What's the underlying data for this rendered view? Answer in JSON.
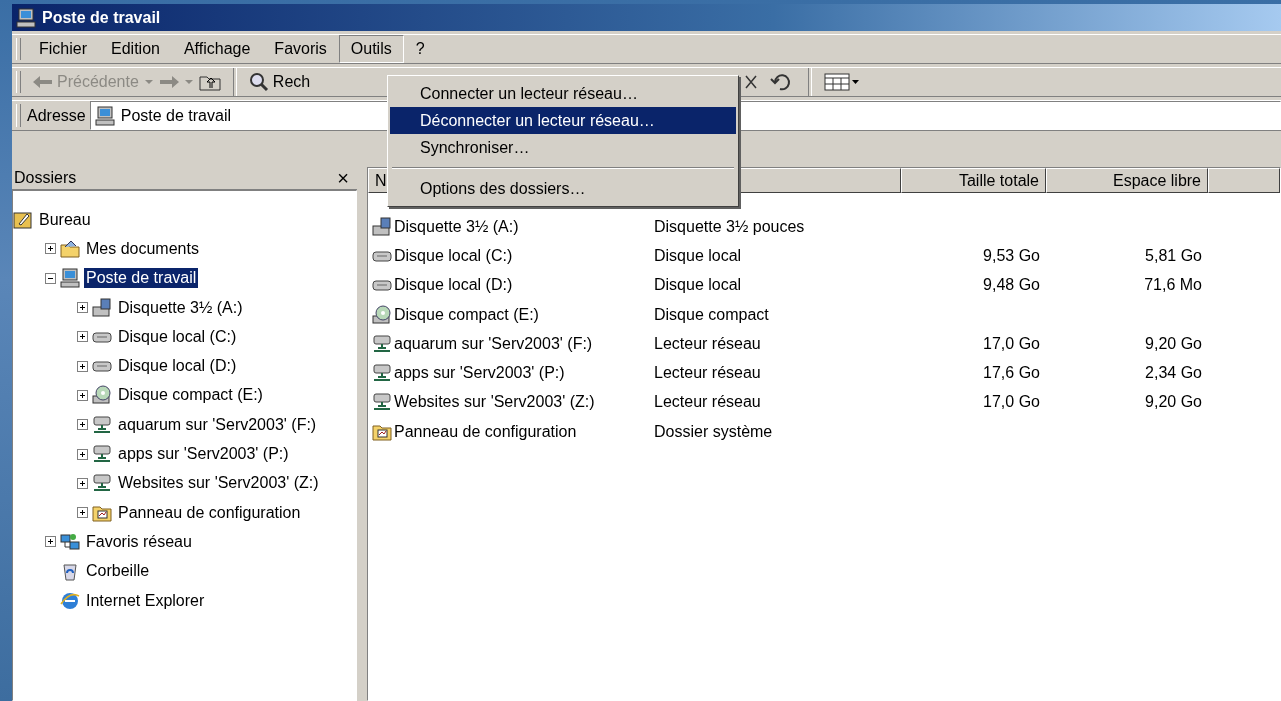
{
  "window": {
    "title": "Poste de travail"
  },
  "menu_bar": [
    {
      "label": "Fichier",
      "selected": false
    },
    {
      "label": "Edition",
      "selected": false
    },
    {
      "label": "Affichage",
      "selected": false
    },
    {
      "label": "Favoris",
      "selected": false
    },
    {
      "label": "Outils",
      "selected": true
    },
    {
      "label": "?",
      "selected": false
    }
  ],
  "toolbar": {
    "back": {
      "label": "Précédente",
      "disabled": true
    },
    "forward": {
      "disabled": true
    },
    "search": {
      "label": "Rech"
    }
  },
  "address": {
    "label": "Adresse",
    "value": "Poste de travail"
  },
  "folders": {
    "title": "Dossiers",
    "close": "×",
    "tree": [
      {
        "label": "Bureau",
        "kind": "desktop",
        "selected": false,
        "children": [
          {
            "label": "Mes documents",
            "kind": "documents",
            "expanded": false,
            "selected": false
          },
          {
            "label": "Poste de travail",
            "kind": "computer",
            "expanded": true,
            "selected": true,
            "children": [
              {
                "label": "Disquette 3½ (A:)",
                "kind": "floppy",
                "expanded": false,
                "selected": false
              },
              {
                "label": "Disque local (C:)",
                "kind": "harddisk",
                "expanded": false,
                "selected": false
              },
              {
                "label": "Disque local (D:)",
                "kind": "harddisk",
                "expanded": false,
                "selected": false
              },
              {
                "label": "Disque compact (E:)",
                "kind": "cdrom",
                "expanded": false,
                "selected": false
              },
              {
                "label": "aquarum sur 'Serv2003' (F:)",
                "kind": "netdrive",
                "expanded": false,
                "selected": false
              },
              {
                "label": "apps sur 'Serv2003' (P:)",
                "kind": "netdrive",
                "expanded": false,
                "selected": false
              },
              {
                "label": "Websites sur 'Serv2003' (Z:)",
                "kind": "netdrive",
                "expanded": false,
                "selected": false
              },
              {
                "label": "Panneau de configuration",
                "kind": "controlpanel",
                "expanded": false,
                "selected": false
              }
            ]
          },
          {
            "label": "Favoris réseau",
            "kind": "network",
            "expanded": false,
            "selected": false
          },
          {
            "label": "Corbeille",
            "kind": "recycle",
            "selected": false
          },
          {
            "label": "Internet Explorer",
            "kind": "browser",
            "selected": false
          }
        ]
      }
    ]
  },
  "list": {
    "columns": [
      {
        "label": "N"
      },
      {},
      {
        "label": "Taille totale"
      },
      {
        "label": "Espace libre"
      }
    ],
    "rows": [
      {
        "name": "Disquette 3½ (A:)",
        "type": "Disquette 3½ pouces",
        "kind": "floppy"
      },
      {
        "name": "Disque local (C:)",
        "type": "Disque local",
        "total": "9,53 Go",
        "free": "5,81 Go",
        "kind": "harddisk"
      },
      {
        "name": "Disque local (D:)",
        "type": "Disque local",
        "total": "9,48 Go",
        "free": "71,6 Mo",
        "kind": "harddisk"
      },
      {
        "name": "Disque compact (E:)",
        "type": "Disque compact",
        "kind": "cdrom"
      },
      {
        "name": "aquarum sur 'Serv2003' (F:)",
        "type": "Lecteur réseau",
        "total": "17,0 Go",
        "free": "9,20 Go",
        "kind": "netdrive"
      },
      {
        "name": "apps sur 'Serv2003' (P:)",
        "type": "Lecteur réseau",
        "total": "17,6 Go",
        "free": "2,34 Go",
        "kind": "netdrive"
      },
      {
        "name": "Websites sur 'Serv2003' (Z:)",
        "type": "Lecteur réseau",
        "total": "17,0 Go",
        "free": "9,20 Go",
        "kind": "netdrive"
      },
      {
        "name": "Panneau de configuration",
        "type": "Dossier système",
        "kind": "controlpanel"
      }
    ]
  },
  "tools_menu": [
    {
      "kind": "item",
      "label": "Connecter un lecteur réseau…",
      "selected": false
    },
    {
      "kind": "item",
      "label": "Déconnecter un lecteur réseau…",
      "selected": true
    },
    {
      "kind": "item",
      "label": "Synchroniser…",
      "selected": false
    },
    {
      "kind": "separator"
    },
    {
      "kind": "item",
      "label": "Options des dossiers…",
      "selected": false
    }
  ]
}
